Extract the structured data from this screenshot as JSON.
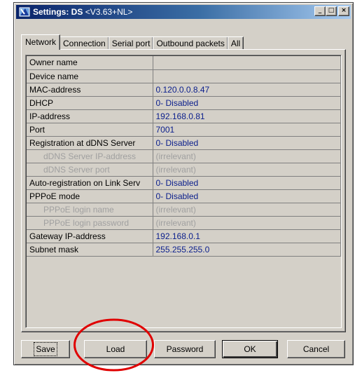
{
  "window": {
    "title": "Settings: DS",
    "version": "<V3.63+NL>",
    "controls": {
      "minimize": "_",
      "maximize": "□",
      "close": "×"
    }
  },
  "tabs": [
    {
      "label": "Network",
      "active": true
    },
    {
      "label": "Connection",
      "active": false
    },
    {
      "label": "Serial port",
      "active": false
    },
    {
      "label": "Outbound packets",
      "active": false
    },
    {
      "label": "All",
      "active": false
    }
  ],
  "properties": [
    {
      "name": "Owner name",
      "value": "",
      "sub": false
    },
    {
      "name": "Device name",
      "value": "",
      "sub": false
    },
    {
      "name": "MAC-address",
      "value": "0.120.0.0.8.47",
      "sub": false
    },
    {
      "name": "DHCP",
      "value": "0- Disabled",
      "sub": false
    },
    {
      "name": "IP-address",
      "value": "192.168.0.81",
      "sub": false
    },
    {
      "name": "Port",
      "value": "7001",
      "sub": false
    },
    {
      "name": "Registration at dDNS Server",
      "value": "0- Disabled",
      "sub": false
    },
    {
      "name": "dDNS Server IP-address",
      "value": "(irrelevant)",
      "sub": true
    },
    {
      "name": "dDNS Server port",
      "value": "(irrelevant)",
      "sub": true
    },
    {
      "name": "Auto-registration on Link Serv",
      "value": "0- Disabled",
      "sub": false
    },
    {
      "name": "PPPoE mode",
      "value": "0- Disabled",
      "sub": false
    },
    {
      "name": "PPPoE login name",
      "value": "(irrelevant)",
      "sub": true
    },
    {
      "name": "PPPoE login password",
      "value": "(irrelevant)",
      "sub": true
    },
    {
      "name": "Gateway IP-address",
      "value": "192.168.0.1",
      "sub": false
    },
    {
      "name": "Subnet mask",
      "value": "255.255.255.0",
      "sub": false
    }
  ],
  "buttons": {
    "save": "Save",
    "load": "Load",
    "password": "Password",
    "ok": "OK",
    "cancel": "Cancel"
  },
  "colors": {
    "title_start": "#0a246a",
    "title_end": "#a6caf0",
    "value_text": "#0a1e8c",
    "annotation": "#e00000"
  }
}
